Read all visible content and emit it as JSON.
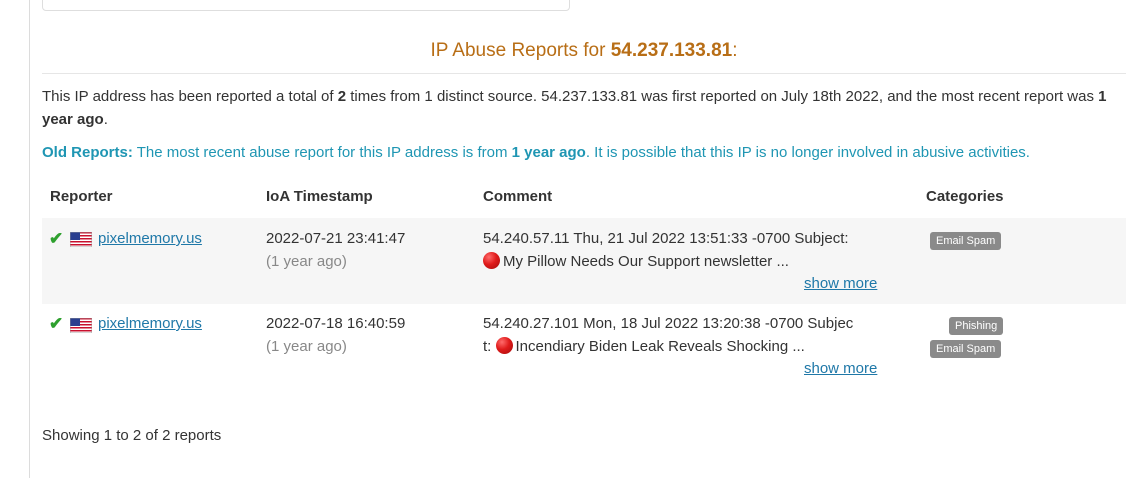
{
  "heading": {
    "prefix": "IP Abuse Reports for ",
    "ip": "54.237.133.81",
    "suffix": ":"
  },
  "summary": {
    "part1": "This IP address has been reported a total of ",
    "count": "2",
    "part2": " times from 1 distinct source. 54.237.133.81 was first reported on July 18th 2022, and the most recent report was ",
    "recent": "1 year ago",
    "part3": "."
  },
  "old_reports": {
    "label": "Old Reports:",
    "part1": " The most recent abuse report for this IP address is from ",
    "recent": "1 year ago",
    "part2": ". It is possible that this IP is no longer involved in abusive activities."
  },
  "table": {
    "headers": {
      "reporter": "Reporter",
      "timestamp": "IoA Timestamp",
      "comment": "Comment",
      "categories": "Categories"
    },
    "rows": [
      {
        "reporter": "pixelmemory.us",
        "timestamp": "2022-07-21 23:41:47",
        "ago": "(1 year ago)",
        "comment_line1": "54.240.57.11 Thu, 21 Jul 2022 13:51:33 -0700 Subject:",
        "comment_line2": "My Pillow Needs Our Support newsletter ...",
        "show_more": "show more",
        "categories": [
          "Email Spam"
        ]
      },
      {
        "reporter": "pixelmemory.us",
        "timestamp": "2022-07-18 16:40:59",
        "ago": "(1 year ago)",
        "comment_line1": "54.240.27.101 Mon, 18 Jul 2022 13:20:38 -0700 Subjec",
        "comment_line2_prefix": "t:",
        "comment_line2": "Incendiary Biden Leak Reveals Shocking ...",
        "show_more": "show more",
        "categories": [
          "Phishing",
          "Email Spam"
        ]
      }
    ]
  },
  "footer": "Showing 1 to 2 of 2 reports",
  "colors": {
    "heading": "#b86e16",
    "old_reports": "#1f96b3",
    "link": "#1f78a8",
    "check": "#2ea02e",
    "badge": "#8a8a8a"
  },
  "icons": {
    "verified": "check-icon",
    "flag": "us-flag-icon",
    "comment_marker": "red-circle-icon"
  }
}
